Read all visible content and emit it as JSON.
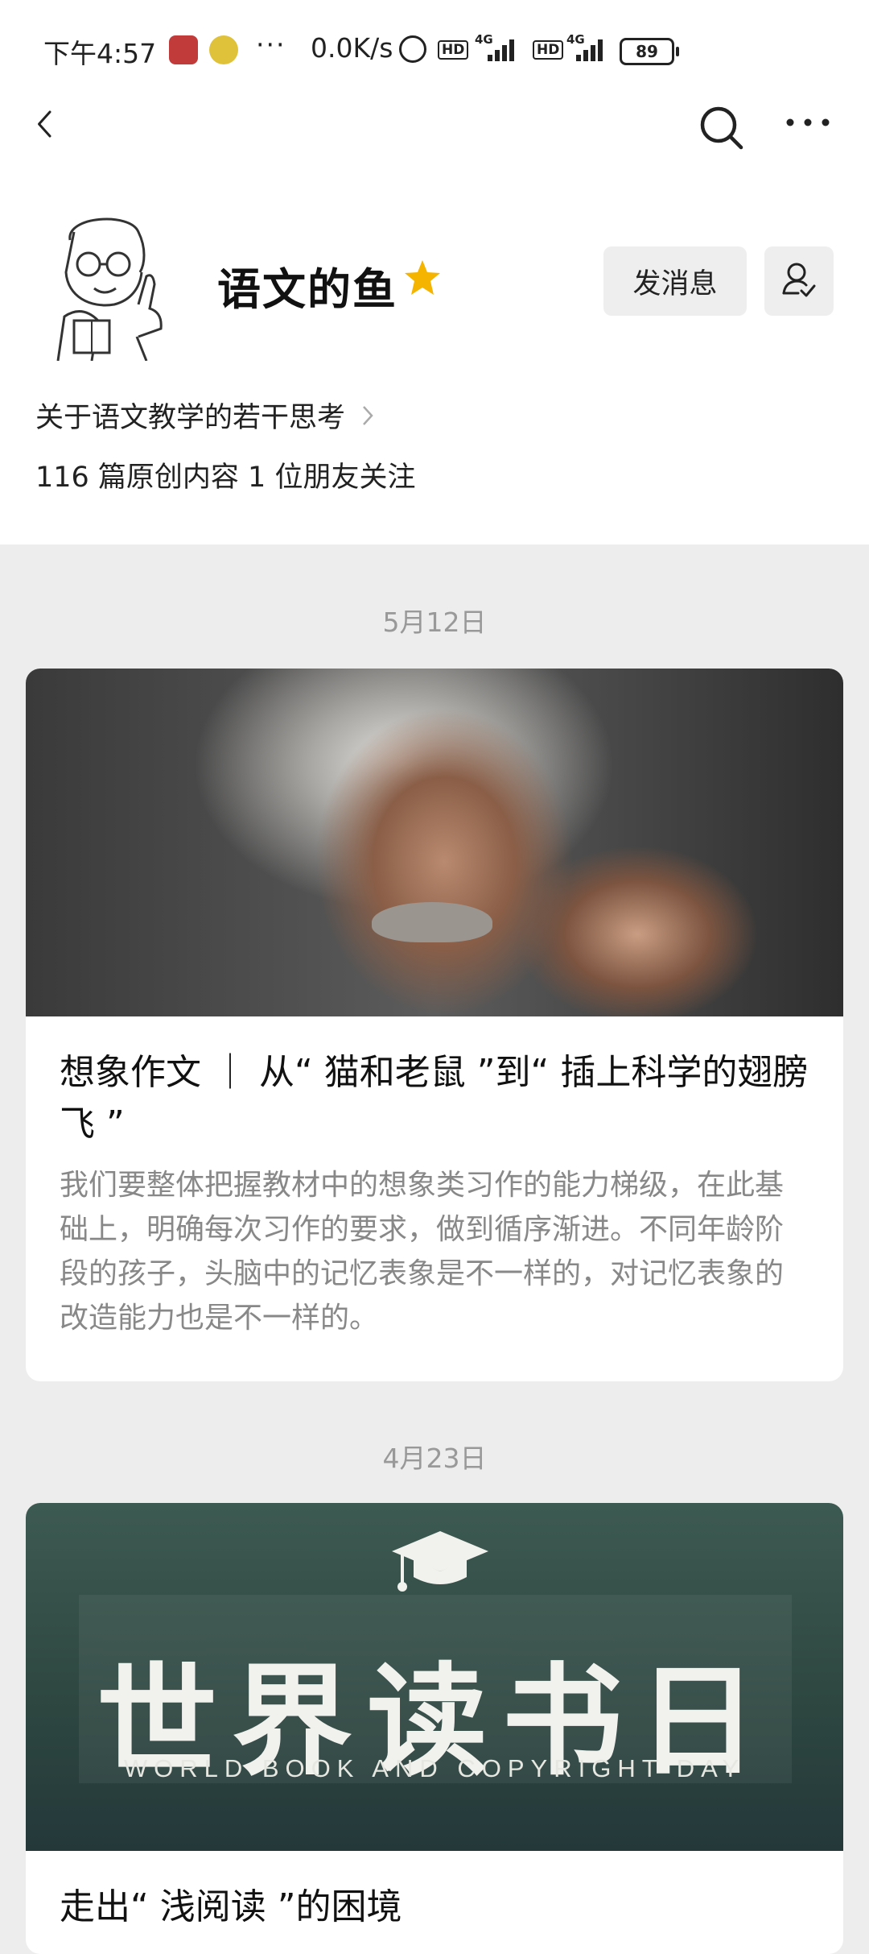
{
  "status_bar": {
    "time": "下午4:57",
    "dots": "···",
    "speed": "0.0K/s",
    "hd1": "HD",
    "net1": "4G",
    "hd2": "HD",
    "net2": "4G",
    "battery": "89"
  },
  "nav": {
    "back_icon": "chevron-left-icon",
    "search_icon": "search-icon",
    "more_icon": "more-horizontal-icon"
  },
  "profile": {
    "name": "语文的鱼",
    "star_color": "#f5b400",
    "message_button": "发消息",
    "follow_icon": "user-check-icon",
    "description": "关于语文教学的若干思考",
    "stats": "116 篇原创内容  1 位朋友关注"
  },
  "feed": [
    {
      "date": "5月12日",
      "title": "想象作文 ｜ 从“ 猫和老鼠 ”到“ 插上科学的翅膀飞 ”",
      "summary": "我们要整体把握教材中的想象类习作的能力梯级，在此基础上，明确每次习作的要求，做到循序渐进。不同年龄阶段的孩子，头脑中的记忆表象是不一样的，对记忆表象的改造能力也是不一样的。"
    },
    {
      "date": "4月23日",
      "image_title": "世界读书日",
      "image_subtitle": "WORLD BOOK AND COPYRIGHT DAY",
      "title": "走出“ 浅阅读 ”的困境"
    }
  ]
}
